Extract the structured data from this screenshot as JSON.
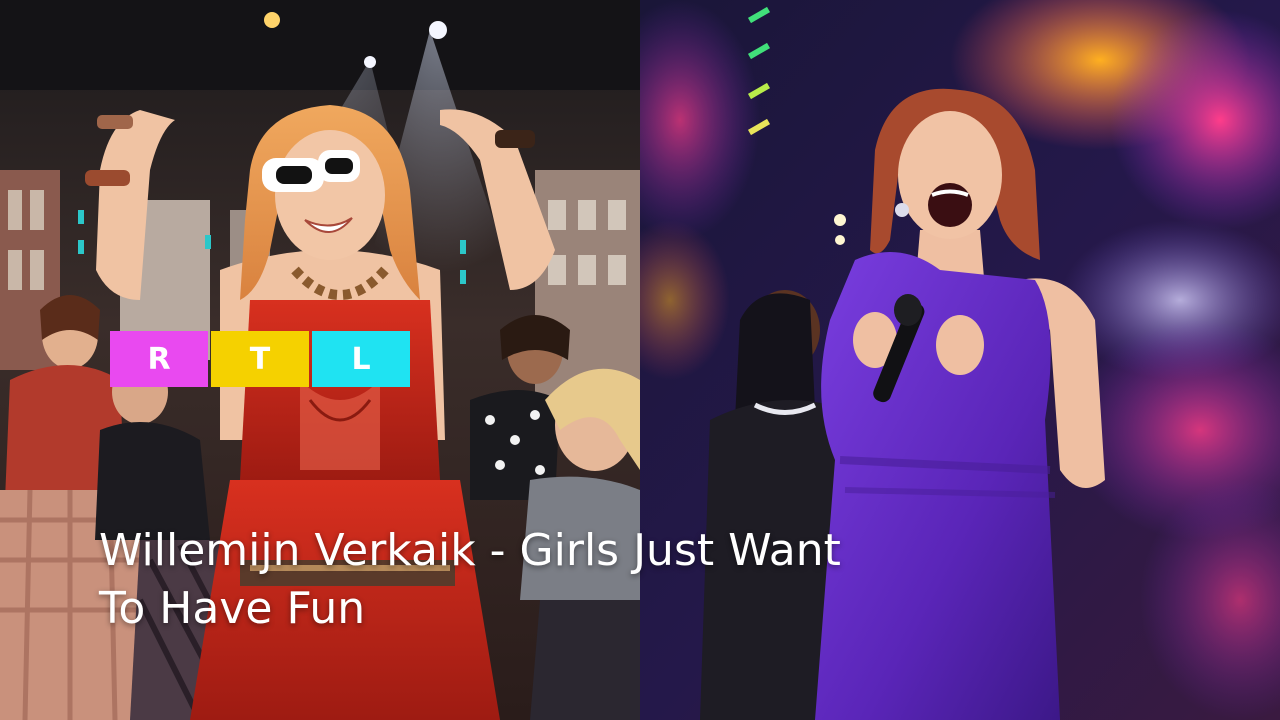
{
  "logo": {
    "letters": [
      "R",
      "T",
      "L"
    ],
    "colors": [
      "#e949f0",
      "#f5d100",
      "#1fe3f2"
    ]
  },
  "caption": {
    "line1": "Willemijn Verkaik - Girls Just Want",
    "line2": "To Have Fun"
  },
  "colors": {
    "left_panel_dominant": "#c2261a",
    "right_panel_dominant": "#5a25b8"
  }
}
